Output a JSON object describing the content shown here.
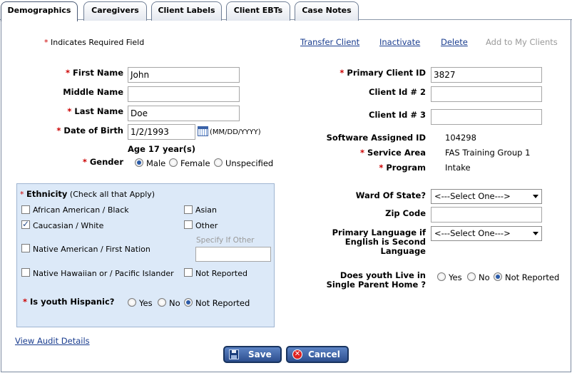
{
  "tabs": [
    "Demographics",
    "Caregivers",
    "Client Labels",
    "Client EBTs",
    "Case Notes"
  ],
  "header": {
    "required_note": "Indicates Required Field",
    "links": [
      "Transfer Client",
      "Inactivate",
      "Delete",
      "Add to My Clients"
    ]
  },
  "left_form": {
    "first_name_label": "First Name",
    "first_name_value": "John",
    "middle_name_label": "Middle Name",
    "middle_name_value": "",
    "last_name_label": "Last Name",
    "last_name_value": "Doe",
    "dob_label": "Date of Birth",
    "dob_value": "1/2/1993",
    "dob_format": "(MM/DD/YYYY)",
    "age_text": "Age 17 year(s)",
    "gender_label": "Gender",
    "gender_options": [
      "Male",
      "Female",
      "Unspecified"
    ],
    "gender_selected": "Male"
  },
  "ethnicity": {
    "title": "Ethnicity",
    "hint": "(Check all that Apply)",
    "options": [
      {
        "label": "African American / Black",
        "checked": false
      },
      {
        "label": "Asian",
        "checked": false
      },
      {
        "label": "Caucasian / White",
        "checked": true
      },
      {
        "label": "Other",
        "checked": false
      },
      {
        "label": "Native American / First Nation",
        "checked": false
      },
      {
        "label": "Native Hawaiian or / Pacific Islander",
        "checked": false
      },
      {
        "label": "Not Reported",
        "checked": false
      }
    ],
    "specify_other_placeholder": "Specify If Other",
    "hispanic_label": "Is youth Hispanic?",
    "hispanic_options": [
      "Yes",
      "No",
      "Not Reported"
    ],
    "hispanic_selected": "Not Reported"
  },
  "right_form": {
    "primary_client_id_label": "Primary Client ID",
    "primary_client_id_value": "3827",
    "client_id2_label": "Client Id # 2",
    "client_id2_value": "",
    "client_id3_label": "Client Id # 3",
    "client_id3_value": "",
    "software_id_label": "Software Assigned ID",
    "software_id_value": "104298",
    "service_area_label": "Service Area",
    "service_area_value": "FAS Training Group 1",
    "program_label": "Program",
    "program_value": "Intake",
    "ward_label": "Ward Of State?",
    "ward_value": "<---Select One--->",
    "zip_label": "Zip Code",
    "zip_value": "",
    "language_label_lines": [
      "Primary Language if",
      "English is Second",
      "Language"
    ],
    "language_value": "<---Select One--->",
    "single_parent_label_lines": [
      "Does youth Live in",
      "Single Parent Home ?"
    ],
    "single_parent_options": [
      "Yes",
      "No",
      "Not Reported"
    ],
    "single_parent_selected": "Not Reported"
  },
  "footer": {
    "audit_link": "View Audit Details",
    "save_label": "Save",
    "cancel_label": "Cancel"
  },
  "colors": {
    "required_star": "#cc0000",
    "link": "#1a3d8f",
    "ethnicity_panel": "#dce9f8",
    "button": "#2d4f8f"
  }
}
